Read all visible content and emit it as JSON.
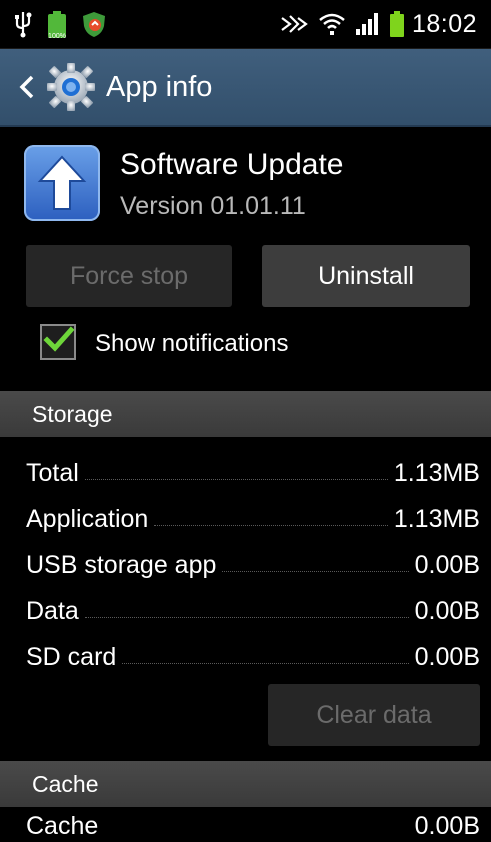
{
  "status_bar": {
    "time": "18:02",
    "battery_small_label": "100%",
    "icons": [
      "usb-icon",
      "battery-icon",
      "shield-icon",
      "nfc-icon",
      "wifi-icon",
      "signal-icon",
      "battery-icon"
    ]
  },
  "titlebar": {
    "title": "App info"
  },
  "app": {
    "name": "Software Update",
    "version": "Version 01.01.11"
  },
  "buttons": {
    "force_stop": "Force stop",
    "uninstall": "Uninstall",
    "clear_data": "Clear data"
  },
  "notifications": {
    "label": "Show notifications",
    "checked": true
  },
  "storage": {
    "header": "Storage",
    "rows": [
      {
        "label": "Total",
        "value": "1.13MB"
      },
      {
        "label": "Application",
        "value": "1.13MB"
      },
      {
        "label": "USB storage app",
        "value": "0.00B"
      },
      {
        "label": "Data",
        "value": "0.00B"
      },
      {
        "label": "SD card",
        "value": "0.00B"
      }
    ]
  },
  "cache": {
    "header": "Cache",
    "rows": [
      {
        "label": "Cache",
        "value": "0.00B"
      }
    ]
  },
  "colors": {
    "titlebar": "#3a5876",
    "check_green": "#6ed63a",
    "battery_green": "#7fd41c"
  }
}
